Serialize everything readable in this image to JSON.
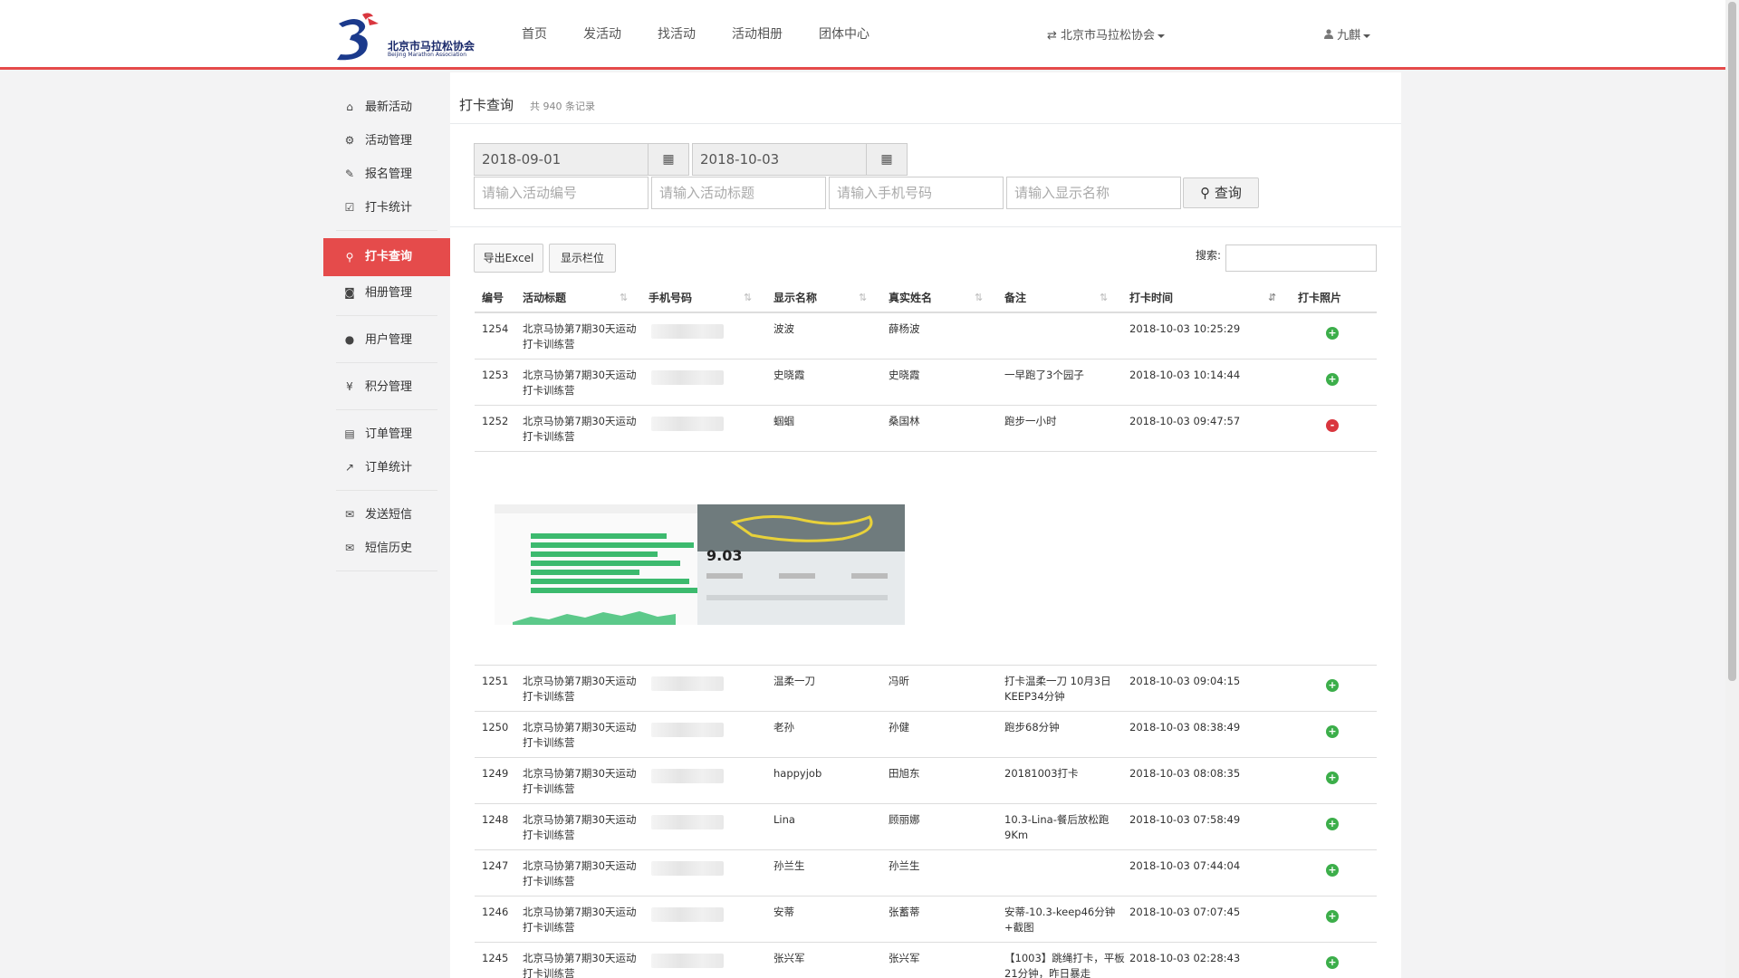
{
  "brand": {
    "name_cn": "北京市马拉松协会",
    "name_en": "Beijing Marathon Association"
  },
  "nav": {
    "links": [
      "首页",
      "发活动",
      "找活动",
      "活动相册",
      "团体中心"
    ],
    "org": "北京市马拉松协会",
    "user": "九麒"
  },
  "sidebar": [
    {
      "label": "最新活动",
      "icon": "home-icon"
    },
    {
      "label": "活动管理",
      "icon": "gear-icon"
    },
    {
      "label": "报名管理",
      "icon": "edit-icon"
    },
    {
      "label": "打卡统计",
      "icon": "checkbox-icon"
    },
    {
      "label": "打卡查询",
      "icon": "search-icon",
      "active": true
    },
    {
      "label": "相册管理",
      "icon": "camera-icon"
    },
    {
      "label": "用户管理",
      "icon": "user-icon"
    },
    {
      "label": "积分管理",
      "icon": "yen-icon"
    },
    {
      "label": "订单管理",
      "icon": "file-icon"
    },
    {
      "label": "订单统计",
      "icon": "line-chart-icon"
    },
    {
      "label": "发送短信",
      "icon": "envelope-icon"
    },
    {
      "label": "短信历史",
      "icon": "envelope-outline-icon"
    }
  ],
  "page": {
    "title": "打卡查询",
    "count": "共 940 条记录"
  },
  "filters": {
    "date_start": "2018-09-01",
    "date_end": "2018-10-03",
    "activity_id_placeholder": "请输入活动编号",
    "activity_title_placeholder": "请输入活动标题",
    "phone_placeholder": "请输入手机号码",
    "display_name_placeholder": "请输入显示名称",
    "query_label": "查询"
  },
  "toolbar": {
    "export_label": "导出Excel",
    "columns_label": "显示栏位",
    "search_label": "搜索:"
  },
  "table": {
    "headers": [
      "编号",
      "活动标题",
      "手机号码",
      "显示名称",
      "真实姓名",
      "备注",
      "打卡时间",
      "打卡照片"
    ],
    "rows_top": [
      {
        "id": "1254",
        "title": "北京马协第7期30天运动打卡训练营",
        "display": "波波",
        "real": "薛杨波",
        "note": "",
        "time": "2018-10-03 10:25:29",
        "status": "+"
      },
      {
        "id": "1253",
        "title": "北京马协第7期30天运动打卡训练营",
        "display": "史晓霞",
        "real": "史晓霞",
        "note": "一早跑了3个园子",
        "time": "2018-10-03 10:14:44",
        "status": "+"
      },
      {
        "id": "1252",
        "title": "北京马协第7期30天运动打卡训练营",
        "display": "蝈蝈",
        "real": "桑国林",
        "note": "跑步一小时",
        "time": "2018-10-03 09:47:57",
        "status": "-"
      }
    ],
    "rows_bottom": [
      {
        "id": "1251",
        "title": "北京马协第7期30天运动打卡训练营",
        "display": "温柔一刀",
        "real": "冯昕",
        "note": "打卡温柔一刀 10月3日 KEEP34分钟",
        "time": "2018-10-03 09:04:15",
        "status": "+"
      },
      {
        "id": "1250",
        "title": "北京马协第7期30天运动打卡训练营",
        "display": "老孙",
        "real": "孙健",
        "note": "跑步68分钟",
        "time": "2018-10-03 08:38:49",
        "status": "+"
      },
      {
        "id": "1249",
        "title": "北京马协第7期30天运动打卡训练营",
        "display": "happyjob",
        "real": "田旭东",
        "note": "20181003打卡",
        "time": "2018-10-03 08:08:35",
        "status": "+"
      },
      {
        "id": "1248",
        "title": "北京马协第7期30天运动打卡训练营",
        "display": "Lina",
        "real": "顾丽娜",
        "note": "10.3-Lina-餐后放松跑9Km",
        "time": "2018-10-03 07:58:49",
        "status": "+"
      },
      {
        "id": "1247",
        "title": "北京马协第7期30天运动打卡训练营",
        "display": "孙兰生",
        "real": "孙兰生",
        "note": "",
        "time": "2018-10-03 07:44:04",
        "status": "+"
      },
      {
        "id": "1246",
        "title": "北京马协第7期30天运动打卡训练营",
        "display": "安蒂",
        "real": "张蓄蒂",
        "note": "安蒂-10.3-keep46分钟+截图",
        "time": "2018-10-03 07:07:45",
        "status": "+"
      },
      {
        "id": "1245",
        "title": "北京马协第7期30天运动打卡训练营",
        "display": "张兴军",
        "real": "张兴军",
        "note": "【1003】跳绳打卡，平板21分钟，昨日暴走",
        "time": "2018-10-03 02:28:43",
        "status": "+"
      }
    ],
    "photo_distance": "9.03"
  },
  "colors": {
    "accent": "#e54b4b",
    "ok": "#3cae4a",
    "no": "#d9363e"
  }
}
